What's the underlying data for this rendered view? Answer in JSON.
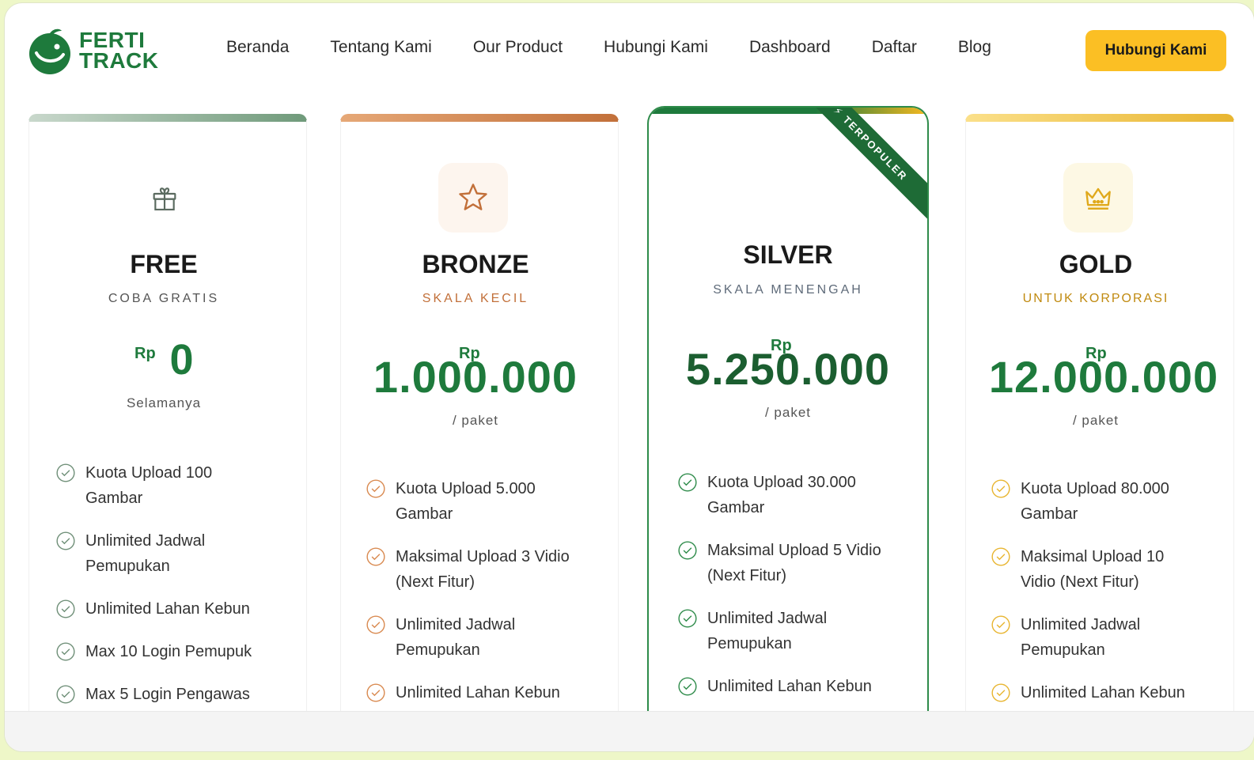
{
  "brand": {
    "line1": "FERTI",
    "line2": "TRACK",
    "color": "#1e7a3c"
  },
  "nav": {
    "links": [
      "Beranda",
      "Tentang Kami",
      "Our Product",
      "Hubungi Kami",
      "Dashboard",
      "Daftar",
      "Blog"
    ],
    "cta": "Hubungi Kami"
  },
  "plans": [
    {
      "name": "FREE",
      "subtitle": "COBA GRATIS",
      "currency": "Rp",
      "amount": "0",
      "period": "Selamanya",
      "accent": "#1e7a3c",
      "icon": "gift-icon",
      "features": [
        "Kuota Upload 100 Gambar",
        "Unlimited Jadwal Pemupukan",
        "Unlimited Lahan Kebun",
        "Max 10 Login Pemupuk",
        "Max 5 Login Pengawas"
      ]
    },
    {
      "name": "BRONZE",
      "subtitle": "SKALA KECIL",
      "currency": "Rp",
      "amount": "1.000.000",
      "period": "/ paket",
      "accent": "#c2703a",
      "icon": "star-icon",
      "features": [
        "Kuota Upload 5.000 Gambar",
        "Maksimal Upload 3 Vidio (Next Fitur)",
        "Unlimited Jadwal Pemupukan",
        "Unlimited Lahan Kebun"
      ]
    },
    {
      "name": "SILVER",
      "subtitle": "SKALA MENENGAH",
      "currency": "Rp",
      "amount": "5.250.000",
      "period": "/ paket",
      "accent": "#1e7a3c",
      "ribbon": "TERPOPULER",
      "features": [
        "Kuota Upload 30.000 Gambar",
        "Maksimal Upload 5 Vidio (Next Fitur)",
        "Unlimited Jadwal Pemupukan",
        "Unlimited Lahan Kebun"
      ]
    },
    {
      "name": "GOLD",
      "subtitle": "UNTUK KORPORASI",
      "currency": "Rp",
      "amount": "12.000.000",
      "period": "/ paket",
      "accent": "#e0a91c",
      "icon": "crown-icon",
      "features": [
        "Kuota Upload 80.000 Gambar",
        "Maksimal Upload 10 Vidio (Next Fitur)",
        "Unlimited Jadwal Pemupukan",
        "Unlimited Lahan Kebun"
      ]
    }
  ]
}
